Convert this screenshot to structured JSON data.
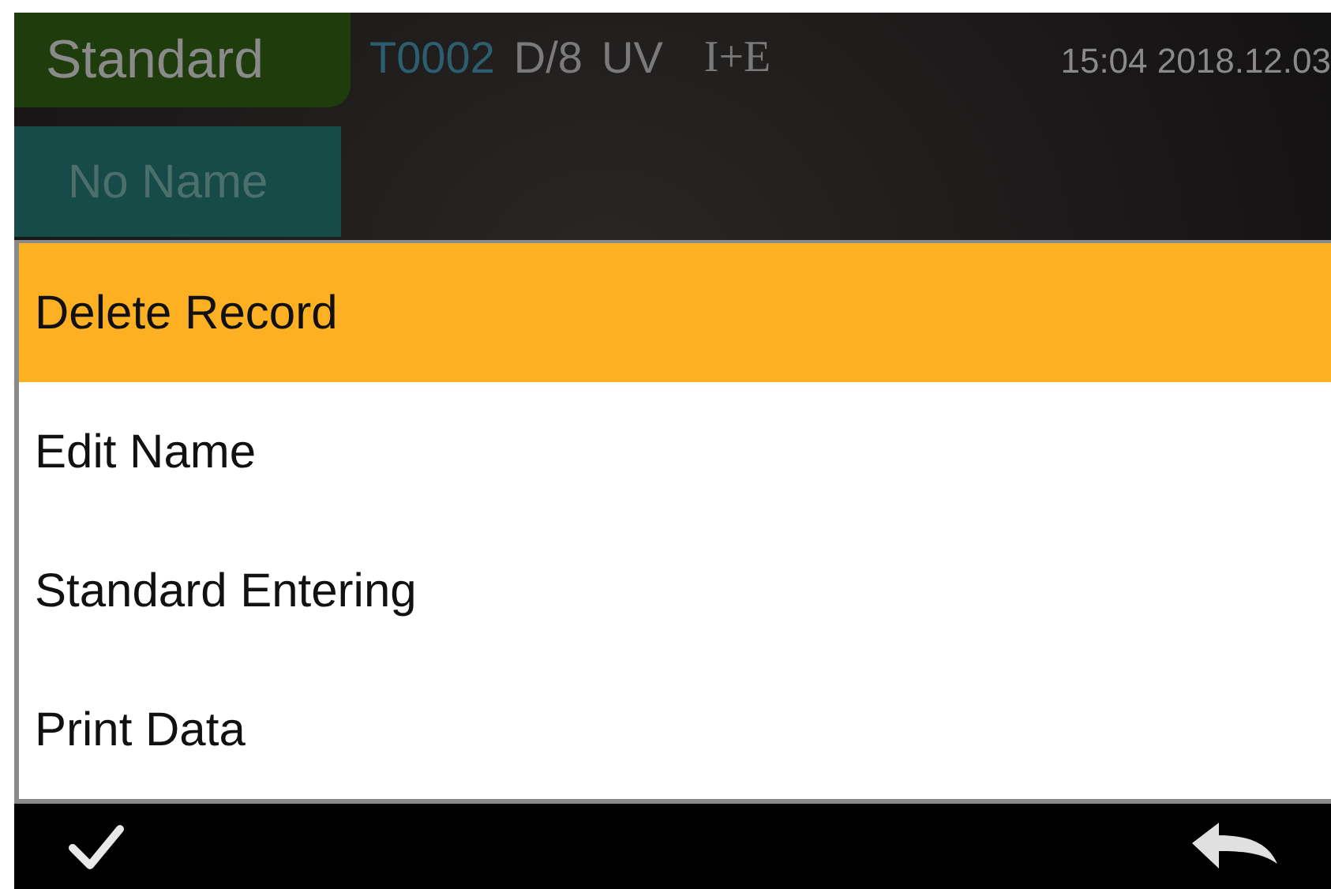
{
  "header": {
    "mode_tab": "Standard",
    "record_id": "T0002",
    "geometry": "D/8",
    "uv": "UV",
    "mode": "I+E",
    "datetime": "15:04 2018.12.03",
    "name_tab": "No Name"
  },
  "menu": [
    {
      "label": "Delete Record",
      "selected": true
    },
    {
      "label": "Edit Name",
      "selected": false
    },
    {
      "label": "Standard Entering",
      "selected": false
    },
    {
      "label": "Print Data",
      "selected": false
    }
  ]
}
